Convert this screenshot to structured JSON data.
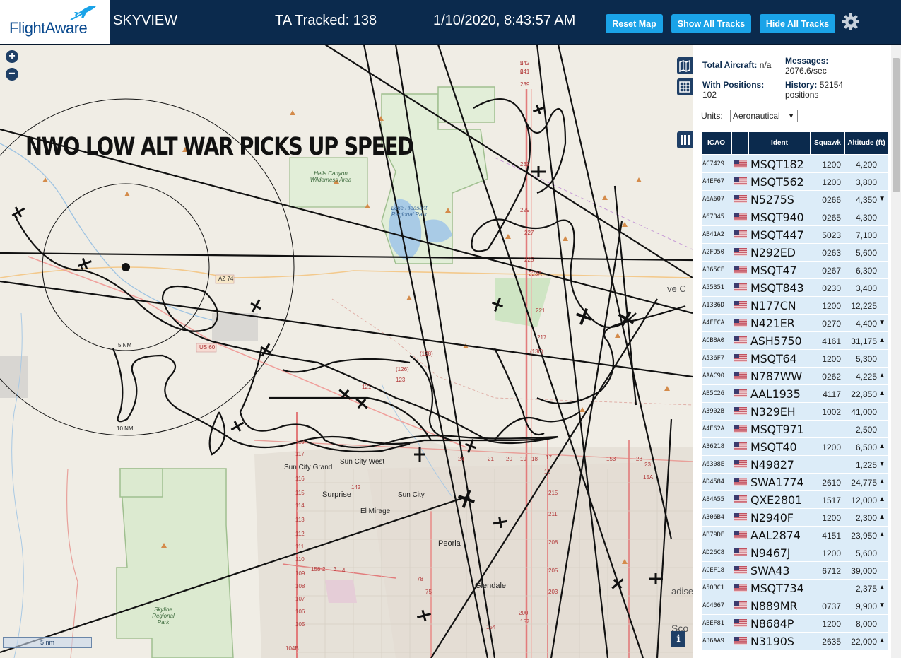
{
  "header": {
    "logo_text": "FlightAware",
    "app_name": "SKYVIEW",
    "tracked": "TA Tracked: 138",
    "datetime": "1/10/2020, 8:43:57 AM",
    "buttons": {
      "reset": "Reset Map",
      "show": "Show All Tracks",
      "hide": "Hide All Tracks"
    },
    "colors": {
      "bar": "#0b2a4d",
      "button": "#1aa3e8"
    }
  },
  "map": {
    "headline": "NWO LOW ALT WAR PICKS UP SPEED",
    "zoom_in": "+",
    "zoom_out": "−",
    "info_button": "i",
    "scale_label": "5 nm",
    "ring_labels": {
      "inner": "5 NM",
      "outer": "10 NM"
    },
    "towns": {
      "sun_city_grand": "Sun City Grand",
      "sun_city_west": "Sun City West",
      "surprise": "Surprise",
      "sun_city": "Sun City",
      "el_mirage": "El Mirage",
      "peoria": "Peoria",
      "glendale": "Glendale",
      "cave_creek": "ve C",
      "paradise": "adise",
      "scottsdale": "Sco"
    },
    "parks": {
      "hells_canyon": "Hells Canyon Wilderness Area",
      "lake_pleasant": "Lake Pleasant Regional Park",
      "skyline": "Skyline Regional Park"
    },
    "shields": {
      "az74": "AZ 74",
      "us60": "US 60"
    },
    "route_numbers": [
      "242",
      "241",
      "239",
      "232",
      "229",
      "227",
      "225",
      "223A",
      "221",
      "217",
      "(130)",
      "(128)",
      "(126)",
      "123",
      "121",
      "119",
      "117",
      "116",
      "115",
      "114",
      "113",
      "112",
      "111",
      "110",
      "109",
      "108",
      "107",
      "106",
      "105",
      "104B",
      "142",
      "78",
      "75",
      "24",
      "21",
      "20",
      "19",
      "18",
      "17",
      "16",
      "215",
      "211",
      "208",
      "205",
      "203",
      "200",
      "157",
      "154",
      "153",
      "28",
      "23",
      "15A",
      "158",
      "2",
      "3",
      "4",
      "5",
      "6"
    ]
  },
  "sidebar": {
    "total_label": "Total Aircraft:",
    "total_value": "n/a",
    "messages_label": "Messages:",
    "messages_value": "2076.6/sec",
    "positions_label": "With Positions:",
    "positions_value": "102",
    "history_label": "History:",
    "history_value": "52154 positions",
    "units_label": "Units:",
    "units_value": "Aeronautical",
    "columns": {
      "icao": "ICAO",
      "ident": "Ident",
      "squawk": "Squawk",
      "altitude": "Altitude (ft)"
    },
    "rows": [
      {
        "icao": "AC7429",
        "ident": "MSQT182",
        "squawk": "1200",
        "alt": "4,200",
        "trend": ""
      },
      {
        "icao": "A4EF67",
        "ident": "MSQT562",
        "squawk": "1200",
        "alt": "3,800",
        "trend": ""
      },
      {
        "icao": "A6A607",
        "ident": "N5275S",
        "squawk": "0266",
        "alt": "4,350",
        "trend": "▼"
      },
      {
        "icao": "A67345",
        "ident": "MSQT940",
        "squawk": "0265",
        "alt": "4,300",
        "trend": ""
      },
      {
        "icao": "AB41A2",
        "ident": "MSQT447",
        "squawk": "5023",
        "alt": "7,100",
        "trend": ""
      },
      {
        "icao": "A2FD50",
        "ident": "N292ED",
        "squawk": "0263",
        "alt": "5,600",
        "trend": ""
      },
      {
        "icao": "A365CF",
        "ident": "MSQT47",
        "squawk": "0267",
        "alt": "6,300",
        "trend": ""
      },
      {
        "icao": "A55351",
        "ident": "MSQT843",
        "squawk": "0230",
        "alt": "3,400",
        "trend": ""
      },
      {
        "icao": "A1336D",
        "ident": "N177CN",
        "squawk": "1200",
        "alt": "12,225",
        "trend": ""
      },
      {
        "icao": "A4FFCA",
        "ident": "N421ER",
        "squawk": "0270",
        "alt": "4,400",
        "trend": "▼"
      },
      {
        "icao": "ACB8A0",
        "ident": "ASH5750",
        "squawk": "4161",
        "alt": "31,175",
        "trend": "▲"
      },
      {
        "icao": "A536F7",
        "ident": "MSQT64",
        "squawk": "1200",
        "alt": "5,300",
        "trend": ""
      },
      {
        "icao": "AAAC90",
        "ident": "N787WW",
        "squawk": "0262",
        "alt": "4,225",
        "trend": "▲"
      },
      {
        "icao": "AB5C26",
        "ident": "AAL1935",
        "squawk": "4117",
        "alt": "22,850",
        "trend": "▲"
      },
      {
        "icao": "A3902B",
        "ident": "N329EH",
        "squawk": "1002",
        "alt": "41,000",
        "trend": ""
      },
      {
        "icao": "A4E62A",
        "ident": "MSQT971",
        "squawk": "",
        "alt": "2,500",
        "trend": ""
      },
      {
        "icao": "A36218",
        "ident": "MSQT40",
        "squawk": "1200",
        "alt": "6,500",
        "trend": "▲"
      },
      {
        "icao": "A6308E",
        "ident": "N49827",
        "squawk": "",
        "alt": "1,225",
        "trend": "▼"
      },
      {
        "icao": "AD4584",
        "ident": "SWA1774",
        "squawk": "2610",
        "alt": "24,775",
        "trend": "▲"
      },
      {
        "icao": "A84A55",
        "ident": "QXE2801",
        "squawk": "1517",
        "alt": "12,000",
        "trend": "▲"
      },
      {
        "icao": "A306B4",
        "ident": "N2940F",
        "squawk": "1200",
        "alt": "2,300",
        "trend": "▲"
      },
      {
        "icao": "AB79DE",
        "ident": "AAL2874",
        "squawk": "4151",
        "alt": "23,950",
        "trend": "▲"
      },
      {
        "icao": "AD26C8",
        "ident": "N9467J",
        "squawk": "1200",
        "alt": "5,600",
        "trend": ""
      },
      {
        "icao": "ACEF18",
        "ident": "SWA43",
        "squawk": "6712",
        "alt": "39,000",
        "trend": ""
      },
      {
        "icao": "A50BC1",
        "ident": "MSQT734",
        "squawk": "",
        "alt": "2,375",
        "trend": "▲"
      },
      {
        "icao": "AC4067",
        "ident": "N889MR",
        "squawk": "0737",
        "alt": "9,900",
        "trend": "▼"
      },
      {
        "icao": "ABEF81",
        "ident": "N8684P",
        "squawk": "1200",
        "alt": "8,000",
        "trend": ""
      },
      {
        "icao": "A36AA9",
        "ident": "N3190S",
        "squawk": "2635",
        "alt": "22,000",
        "trend": "▲"
      }
    ]
  }
}
